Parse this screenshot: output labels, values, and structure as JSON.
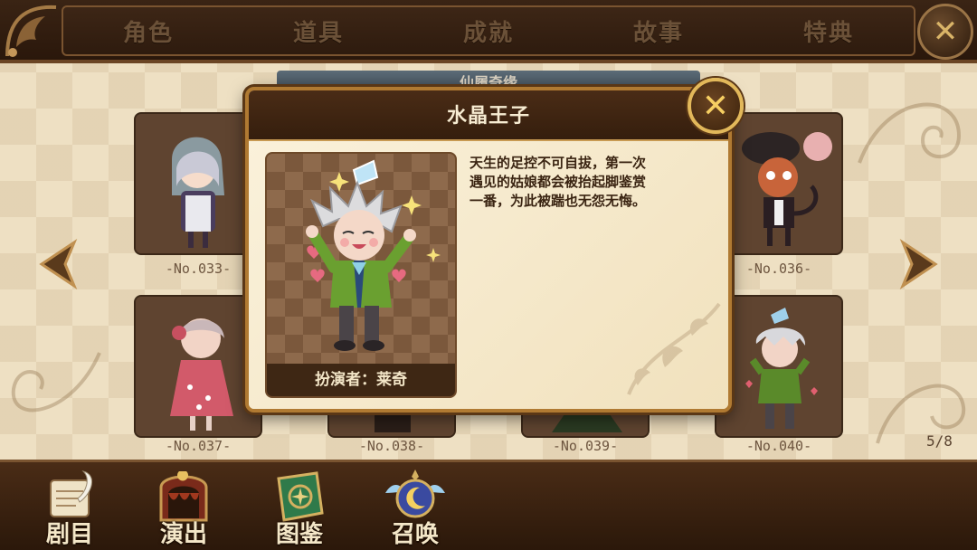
{
  "tabs": [
    {
      "label": "角色"
    },
    {
      "label": "道具"
    },
    {
      "label": "成就"
    },
    {
      "label": "故事"
    },
    {
      "label": "特典"
    }
  ],
  "section_title": "仙履奇缘",
  "cards": [
    {
      "number": "-No.033-"
    },
    {
      "number": "-No.036-"
    },
    {
      "number": "-No.037-"
    },
    {
      "number": "-No.038-"
    },
    {
      "number": "-No.039-"
    },
    {
      "number": "-No.040-"
    }
  ],
  "page_indicator": "5/8",
  "modal": {
    "title": "水晶王子",
    "performer": "扮演者：莱奇",
    "description_lines": [
      "天生的足控不可自拔，第一次",
      "遇见的姑娘都会被抬起脚鉴赏",
      "一番，为此被踹也无怨无悔。"
    ]
  },
  "bottom_nav": [
    {
      "label": "剧目",
      "icon": "scroll-quill-icon"
    },
    {
      "label": "演出",
      "icon": "theater-stage-icon"
    },
    {
      "label": "图鉴",
      "icon": "book-icon"
    },
    {
      "label": "召唤",
      "icon": "moon-orb-icon"
    }
  ],
  "colors": {
    "accent_gold": "#e2b85a",
    "dark_brown": "#351e0d",
    "parchment": "#f5ead0",
    "tab_text": "#6b5138"
  }
}
